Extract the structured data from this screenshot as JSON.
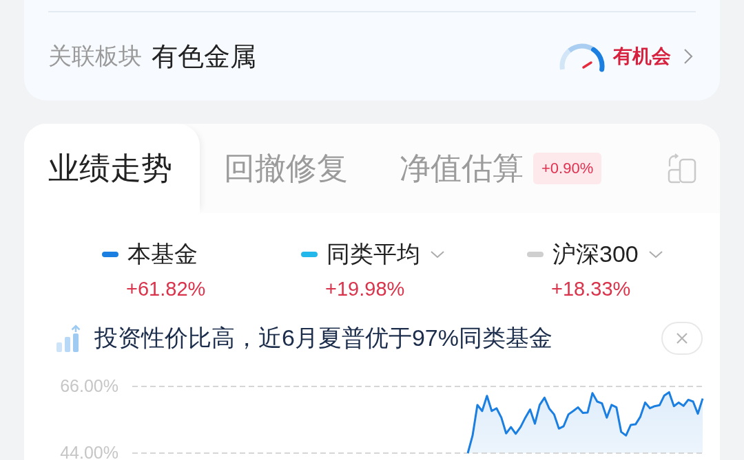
{
  "sector_card": {
    "label": "关联板块",
    "value": "有色金属",
    "signal": "有机会"
  },
  "performance": {
    "tabs": [
      {
        "label": "业绩走势",
        "selected": true
      },
      {
        "label": "回撤修复",
        "selected": false
      },
      {
        "label": "净值估算",
        "selected": false,
        "badge": "+0.90%"
      }
    ],
    "legend": [
      {
        "name": "本基金",
        "change": "+61.82%",
        "color": "#1a7fe0",
        "dropdown": false
      },
      {
        "name": "同类平均",
        "change": "+19.98%",
        "color": "#22b8ec",
        "dropdown": true
      },
      {
        "name": "沪深300",
        "change": "+18.33%",
        "color": "#cfcfcf",
        "dropdown": true
      }
    ],
    "tip": {
      "text": "投资性价比高，近6月夏普优于97%同类基金"
    },
    "chart_data": [
      {
        "type": "area",
        "tick_labels": "y",
        "ylim": [
          44,
          66
        ],
        "yticks": [
          {
            "value": 66,
            "label": "66.00%"
          },
          {
            "value": 44,
            "label": "44.00%"
          }
        ],
        "color": "#1a7fe0",
        "values": [
          null,
          null,
          null,
          null,
          null,
          null,
          null,
          null,
          null,
          null,
          null,
          null,
          null,
          null,
          null,
          null,
          null,
          null,
          null,
          null,
          null,
          null,
          null,
          null,
          null,
          null,
          null,
          null,
          null,
          null,
          null,
          null,
          null,
          null,
          null,
          null,
          null,
          null,
          null,
          null,
          null,
          null,
          null,
          null,
          null,
          null,
          null,
          null,
          null,
          null,
          null,
          null,
          null,
          null,
          null,
          null,
          null,
          null,
          null,
          null,
          null,
          null,
          null,
          null,
          null,
          null,
          null,
          null,
          null,
          null,
          44.0,
          49.8,
          59.9,
          57.9,
          62.9,
          57.9,
          58.8,
          55.7,
          50.5,
          52.6,
          50.4,
          52.6,
          55.7,
          58.4,
          53.7,
          59.9,
          62.3,
          58.7,
          56.8,
          52.1,
          52.9,
          56.8,
          57.9,
          59.1,
          57.3,
          57.4,
          63.8,
          61.0,
          60.4,
          55.7,
          59.9,
          59.1,
          51.0,
          49.8,
          53.3,
          53.5,
          56.0,
          60.7,
          58.8,
          59.5,
          59.8,
          63.0,
          64.1,
          59.5,
          60.7,
          59.6,
          61.6,
          61.0,
          57.0,
          62.0
        ]
      }
    ]
  }
}
